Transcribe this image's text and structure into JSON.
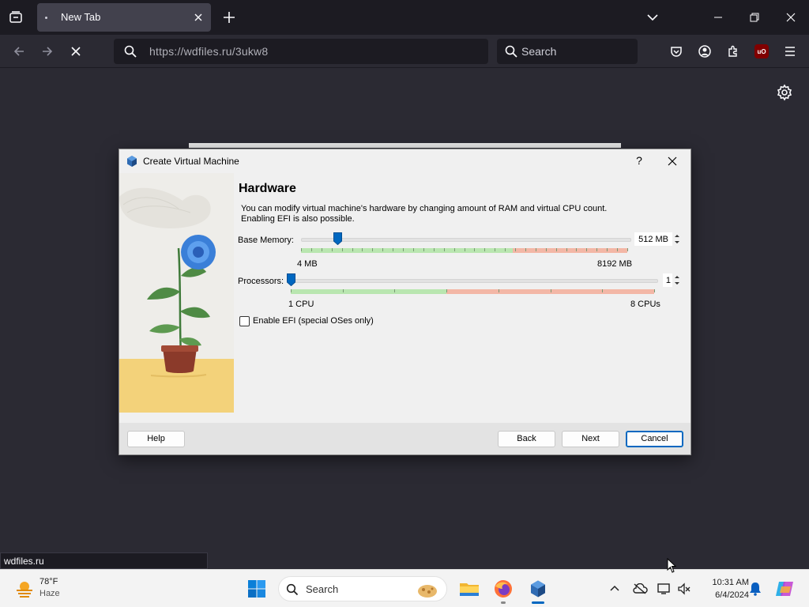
{
  "browser": {
    "tab_title": "New Tab",
    "url_host": "https://wdfiles.ru",
    "url_path": "/3ukw8",
    "search_placeholder": "Search",
    "status_link": "wdfiles.ru"
  },
  "dialog": {
    "title": "Create Virtual Machine",
    "help_glyph": "?",
    "section_title": "Hardware",
    "description_line1": "You can modify virtual machine's hardware by changing amount of RAM and virtual CPU count.",
    "description_line2": "Enabling EFI is also possible.",
    "memory": {
      "label": "Base Memory:",
      "value": "512 MB",
      "min_label": "4 MB",
      "max_label": "8192 MB",
      "current_mb": 512,
      "min_mb": 4,
      "max_mb": 8192
    },
    "processors": {
      "label": "Processors:",
      "value": "1",
      "min_label": "1 CPU",
      "max_label": "8 CPUs",
      "current": 1,
      "min": 1,
      "max": 8
    },
    "efi_label": "Enable EFI (special OSes only)",
    "efi_checked": false,
    "buttons": {
      "help": "Help",
      "back": "Back",
      "next": "Next",
      "cancel": "Cancel"
    }
  },
  "taskbar": {
    "weather_temp": "78°F",
    "weather_cond": "Haze",
    "search_placeholder": "Search",
    "time": "10:31 AM",
    "date": "6/4/2024"
  },
  "colors": {
    "browser_bg": "#2b2a33",
    "tab_strip": "#1c1b22",
    "accent": "#0067c0",
    "slider_green": "#b9e6b0",
    "slider_red": "#f3b7a6"
  }
}
